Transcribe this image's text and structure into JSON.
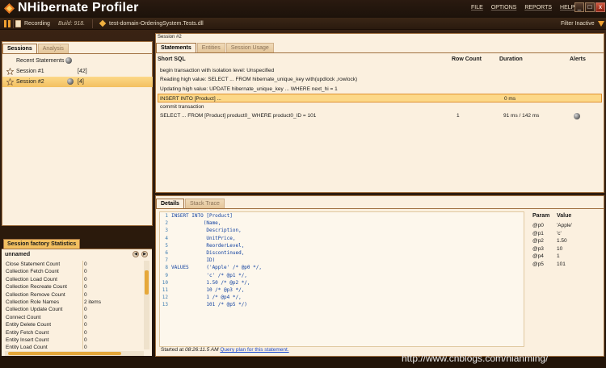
{
  "app": {
    "title": "NHibernate Profiler",
    "menu": [
      "FILE",
      "OPTIONS",
      "REPORTS",
      "HELP"
    ],
    "window_buttons": [
      "_",
      "□",
      "x"
    ]
  },
  "toolbar": {
    "recording": "Recording",
    "build": "Build: 918.",
    "assembly": "test-domain-OrderingSystem.Tests.dll",
    "filter": "Filter Inactive"
  },
  "sessions_panel": {
    "tabs": [
      "Sessions",
      "Analysis"
    ],
    "items": [
      {
        "label": "Recent Statements",
        "count": ""
      },
      {
        "label": "Session #1",
        "count": "[42]"
      },
      {
        "label": "Session #2",
        "count": "[4]"
      }
    ]
  },
  "factory_panel": {
    "tab": "Session factory Statistics",
    "name": "unnamed",
    "nav_prev": "◀",
    "nav_next": "▶",
    "rows": [
      {
        "name": "Close Statement Count",
        "value": "0"
      },
      {
        "name": "Collection Fetch Count",
        "value": "0"
      },
      {
        "name": "Collection Load Count",
        "value": "0"
      },
      {
        "name": "Collection Recreate Count",
        "value": "0"
      },
      {
        "name": "Collection Remove Count",
        "value": "0"
      },
      {
        "name": "Collection Role Names",
        "value": "2 items"
      },
      {
        "name": "Collection Update Count",
        "value": "0"
      },
      {
        "name": "Connect Count",
        "value": "0"
      },
      {
        "name": "Entity Delete Count",
        "value": "0"
      },
      {
        "name": "Entity Fetch Count",
        "value": "0"
      },
      {
        "name": "Entity Insert Count",
        "value": "0"
      },
      {
        "name": "Entity Load Count",
        "value": "0"
      }
    ]
  },
  "session_view": {
    "caption": "Session #2",
    "tabs": [
      "Statements",
      "Entities",
      "Session Usage"
    ],
    "columns": {
      "sql": "Short SQL",
      "rows": "Row Count",
      "duration": "Duration",
      "alerts": "Alerts"
    },
    "statements": [
      {
        "sql": "begin transaction with isolation level: Unspecified",
        "rows": "",
        "duration": ""
      },
      {
        "sql": "Reading high value: SELECT ... FROM hibernate_unique_key with(updlock ,rowlock)",
        "rows": "",
        "duration": ""
      },
      {
        "sql": "Updating high value: UPDATE hibernate_unique_key ... WHERE next_hi = 1",
        "rows": "",
        "duration": ""
      },
      {
        "sql": "INSERT INTO [Product] ...",
        "rows": "",
        "duration": "0 ms"
      },
      {
        "sql": "commit transaction",
        "rows": "",
        "duration": ""
      },
      {
        "sql": "SELECT ... FROM [Product] product0_ WHERE product0_ID = 101",
        "rows": "1",
        "duration": "91 ms / 142 ms"
      }
    ]
  },
  "details": {
    "tabs": [
      "Details",
      "Stack Trace"
    ],
    "code": [
      {
        "n": "1",
        "text": "INSERT INTO [Product]"
      },
      {
        "n": "2",
        "text": "           (Name,"
      },
      {
        "n": "3",
        "text": "            Description,"
      },
      {
        "n": "4",
        "text": "            UnitPrice,"
      },
      {
        "n": "5",
        "text": "            ReorderLevel,"
      },
      {
        "n": "6",
        "text": "            Discontinued,"
      },
      {
        "n": "7",
        "text": "            ID)"
      },
      {
        "n": "8",
        "text": "VALUES      ('Apple' /* @p0 */,"
      },
      {
        "n": "9",
        "text": "            'c' /* @p1 */,"
      },
      {
        "n": "10",
        "text": "            1.50 /* @p2 */,"
      },
      {
        "n": "11",
        "text": "            10 /* @p3 */,"
      },
      {
        "n": "12",
        "text": "            1 /* @p4 */,"
      },
      {
        "n": "13",
        "text": "            101 /* @p5 */)"
      }
    ],
    "param_header": {
      "param": "Param",
      "value": "Value"
    },
    "params": [
      {
        "param": "@p0",
        "value": "'Apple'"
      },
      {
        "param": "@p1",
        "value": "'c'"
      },
      {
        "param": "@p2",
        "value": "1.50"
      },
      {
        "param": "@p3",
        "value": "10"
      },
      {
        "param": "@p4",
        "value": "1"
      },
      {
        "param": "@p5",
        "value": "101"
      }
    ],
    "started_label": "Started at",
    "started_time": "08:26:11.5 AM",
    "query_plan_link": "Query plan for this statement."
  },
  "watermark": "http://www.cnblogs.com/nianming/",
  "colors": {
    "accent": "#f3c060",
    "panel": "#fbf0df",
    "chrome": "#2a1a10"
  }
}
